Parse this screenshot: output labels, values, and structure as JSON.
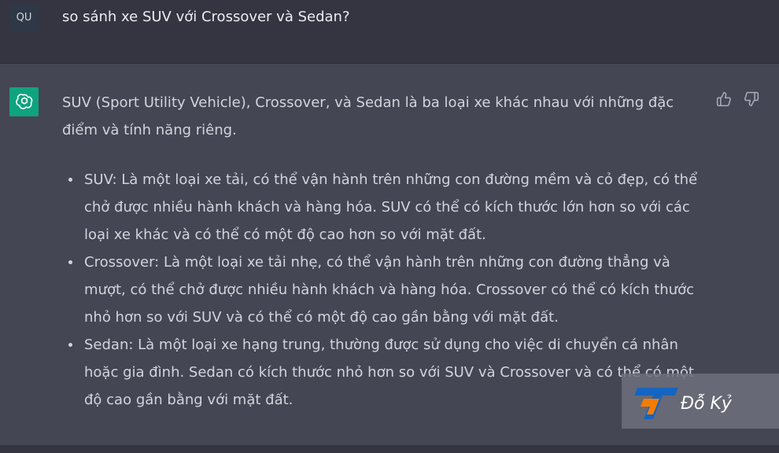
{
  "user": {
    "avatar_initials": "QU",
    "message": "so sánh xe SUV với Crossover và Sedan?"
  },
  "assistant": {
    "avatar_icon": "openai-logo-icon",
    "intro": "SUV (Sport Utility Vehicle), Crossover, và Sedan là ba loại xe khác nhau với những đặc điểm và tính năng riêng.",
    "items": [
      "SUV: Là một loại xe tải, có thể vận hành trên những con đường mềm và cỏ đẹp, có thể chở được nhiều hành khách và hàng hóa. SUV có thể có kích thước lớn hơn so với các loại xe khác và có thể có một độ cao hơn so với mặt đất.",
      "Crossover: Là một loại xe tải nhẹ, có thể vận hành trên những con đường thẳng và mượt, có thể chở được nhiều hành khách và hàng hóa. Crossover có thể có kích thước nhỏ hơn so với SUV và có thể có một độ cao gần bằng với mặt đất.",
      "Sedan: Là một loại xe hạng trung, thường được sử dụng cho việc di chuyển cá nhân hoặc gia đình. Sedan có kích thước nhỏ hơn so với SUV và Crossover và có thể có một độ cao gần bằng với mặt đất."
    ]
  },
  "feedback": {
    "thumbs_up_icon": "thumbs-up-icon",
    "thumbs_down_icon": "thumbs-down-icon"
  },
  "watermark": {
    "text": "Đỗ Kỷ",
    "logo_colors": [
      "#1565c0",
      "#f57c00"
    ]
  },
  "colors": {
    "user_bg": "#343541",
    "assistant_bg": "#444654",
    "accent": "#10a37f"
  }
}
